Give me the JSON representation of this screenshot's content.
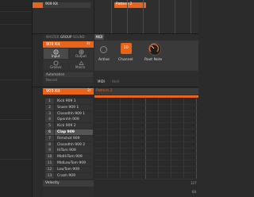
{
  "top": {
    "kit_title": "909 Kit",
    "pattern_title": "Pattern 2"
  },
  "sound_panel": {
    "tabs": [
      "MASTER",
      "GROUP",
      "SOUND"
    ],
    "group_name": "909 Kit",
    "group_number": "2/",
    "buttons": [
      "Input",
      "Output",
      "Groove",
      "Macro"
    ],
    "automation_label": "Automation",
    "record_label": "Record"
  },
  "midi_panel": {
    "tab": "MIDI",
    "controls": [
      "Active",
      "Channel",
      "Root Note"
    ],
    "channel_value": "10",
    "subtabs": [
      "MIDI",
      "Host"
    ]
  },
  "pads": {
    "group": "909 Kit",
    "pattern": "Pattern 2",
    "rows": [
      {
        "num": "1",
        "name": "Kick 909 1"
      },
      {
        "num": "2",
        "name": "Snare 909 1"
      },
      {
        "num": "3",
        "name": "Closedhh 909 1"
      },
      {
        "num": "4",
        "name": "Openhh 909"
      },
      {
        "num": "5",
        "name": "Kick 909 2"
      },
      {
        "num": "6",
        "name": "Clap 909"
      },
      {
        "num": "7",
        "name": "Rimshot 909"
      },
      {
        "num": "8",
        "name": "Closedhh 909 2"
      },
      {
        "num": "9",
        "name": "HiTom 909"
      },
      {
        "num": "10",
        "name": "MidHiTom 909"
      },
      {
        "num": "11",
        "name": "MidLowTom 909"
      },
      {
        "num": "12",
        "name": "LowTom 909"
      },
      {
        "num": "13",
        "name": "Crash 909"
      }
    ],
    "selected_index": 5
  },
  "bottom": {
    "velocity_label": "Velocity",
    "val_top": "127",
    "val_bottom": "64"
  },
  "colors": {
    "accent": "#e8641b"
  }
}
